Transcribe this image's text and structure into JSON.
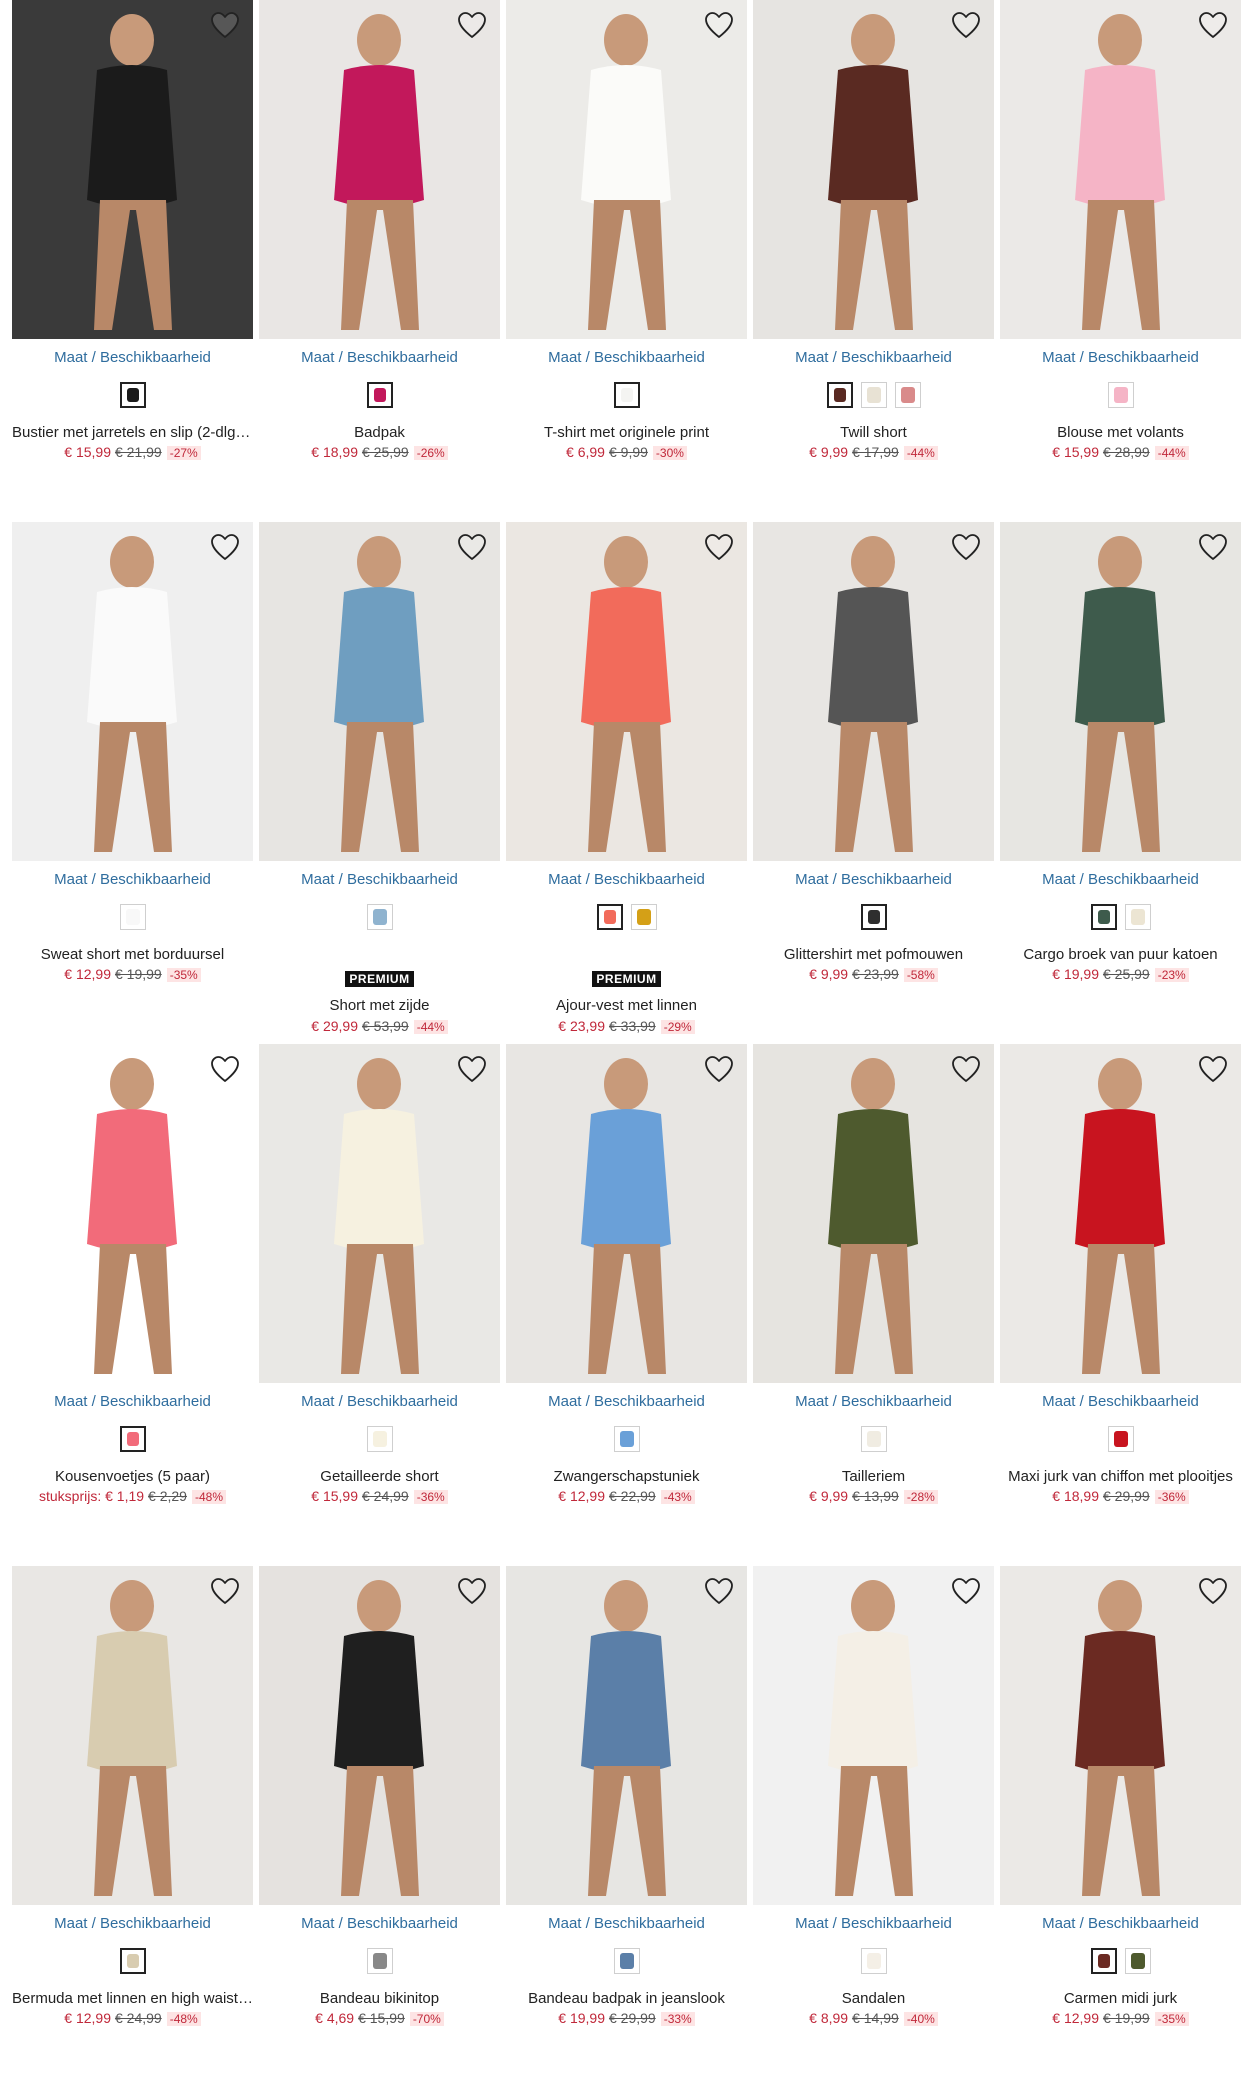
{
  "maat_label": "Maat / Beschikbaarheid",
  "premium_label": "PREMIUM",
  "rows": [
    {
      "products": [
        {
          "name": "Bustier met jarretels en slip (2-dlg. ...",
          "price_prefix": "",
          "price": "€ 15,99",
          "old_price": "€ 21,99",
          "discount": "-27%",
          "premium": false,
          "bg": "#3a3a3a",
          "accent": "#1b1b1b",
          "swatches": [
            {
              "color": "#1a1a1a",
              "selected": true
            }
          ]
        },
        {
          "name": "Badpak",
          "price_prefix": "",
          "price": "€ 18,99",
          "old_price": "€ 25,99",
          "discount": "-26%",
          "premium": false,
          "bg": "#e9e6e4",
          "accent": "#c2185b",
          "swatches": [
            {
              "color": "#c2185b",
              "selected": true
            }
          ]
        },
        {
          "name": "T-shirt met originele print",
          "price_prefix": "",
          "price": "€ 6,99",
          "old_price": "€ 9,99",
          "discount": "-30%",
          "premium": false,
          "bg": "#ecebe8",
          "accent": "#fbfbf9",
          "swatches": [
            {
              "color": "#f4f4f2",
              "selected": true
            }
          ]
        },
        {
          "name": "Twill short",
          "price_prefix": "",
          "price": "€ 9,99",
          "old_price": "€ 17,99",
          "discount": "-44%",
          "premium": false,
          "bg": "#e6e4e1",
          "accent": "#5a2a22",
          "swatches": [
            {
              "color": "#5a2a22",
              "selected": true
            },
            {
              "color": "#e8e2d4",
              "selected": false
            },
            {
              "color": "#d98a8a",
              "selected": false
            }
          ]
        },
        {
          "name": "Blouse met volants",
          "price_prefix": "",
          "price": "€ 15,99",
          "old_price": "€ 28,99",
          "discount": "-44%",
          "premium": false,
          "bg": "#ebe9e7",
          "accent": "#f5b4c6",
          "swatches": [
            {
              "color": "#f5b4c6",
              "selected": false
            }
          ]
        }
      ]
    },
    {
      "products": [
        {
          "name": "Sweat short met borduursel",
          "price_prefix": "",
          "price": "€ 12,99",
          "old_price": "€ 19,99",
          "discount": "-35%",
          "premium": false,
          "bg": "#efefef",
          "accent": "#fafafa",
          "swatches": [
            {
              "color": "#f8f8f8",
              "selected": false
            }
          ]
        },
        {
          "name": "Short met zijde",
          "price_prefix": "",
          "price": "€ 29,99",
          "old_price": "€ 53,99",
          "discount": "-44%",
          "premium": true,
          "bg": "#e7e5e2",
          "accent": "#6f9ec0",
          "swatches": [
            {
              "color": "#8fb3cf",
              "selected": false
            }
          ]
        },
        {
          "name": "Ajour-vest met linnen",
          "price_prefix": "",
          "price": "€ 23,99",
          "old_price": "€ 33,99",
          "discount": "-29%",
          "premium": true,
          "bg": "#ebe7e2",
          "accent": "#f26b5b",
          "swatches": [
            {
              "color": "#f26b5b",
              "selected": true
            },
            {
              "color": "#d4a017",
              "selected": false
            }
          ]
        },
        {
          "name": "Glittershirt met pofmouwen",
          "price_prefix": "",
          "price": "€ 9,99",
          "old_price": "€ 23,99",
          "discount": "-58%",
          "premium": false,
          "bg": "#e8e6e3",
          "accent": "#555555",
          "swatches": [
            {
              "color": "#2e2e2e",
              "selected": true
            }
          ]
        },
        {
          "name": "Cargo broek van puur katoen",
          "price_prefix": "",
          "price": "€ 19,99",
          "old_price": "€ 25,99",
          "discount": "-23%",
          "premium": false,
          "bg": "#e7e6e2",
          "accent": "#3e5b4c",
          "swatches": [
            {
              "color": "#3e5b4c",
              "selected": true
            },
            {
              "color": "#ece5d3",
              "selected": false
            }
          ]
        }
      ]
    },
    {
      "products": [
        {
          "name": "Kousenvoetjes (5 paar)",
          "price_prefix": "stuksprijs:",
          "price": "€ 1,19",
          "old_price": "€ 2,29",
          "discount": "-48%",
          "premium": false,
          "bg": "#ffffff",
          "accent": "#f26b7a",
          "swatches": [
            {
              "color": "#f26b7a",
              "selected": true
            }
          ]
        },
        {
          "name": "Getailleerde short",
          "price_prefix": "",
          "price": "€ 15,99",
          "old_price": "€ 24,99",
          "discount": "-36%",
          "premium": false,
          "bg": "#e9e8e5",
          "accent": "#f6f1e0",
          "swatches": [
            {
              "color": "#f6f1e0",
              "selected": false
            }
          ]
        },
        {
          "name": "Zwangerschapstuniek",
          "price_prefix": "",
          "price": "€ 12,99",
          "old_price": "€ 22,99",
          "discount": "-43%",
          "premium": false,
          "bg": "#e8e6e3",
          "accent": "#6aa0d8",
          "swatches": [
            {
              "color": "#6aa0d8",
              "selected": false
            }
          ]
        },
        {
          "name": "Tailleriem",
          "price_prefix": "",
          "price": "€ 9,99",
          "old_price": "€ 13,99",
          "discount": "-28%",
          "premium": false,
          "bg": "#e6e4e0",
          "accent": "#4e5a2e",
          "swatches": [
            {
              "color": "#f0ece2",
              "selected": false
            }
          ]
        },
        {
          "name": "Maxi jurk van chiffon met plooitjes",
          "price_prefix": "",
          "price": "€ 18,99",
          "old_price": "€ 29,99",
          "discount": "-36%",
          "premium": false,
          "bg": "#ebe9e6",
          "accent": "#c8141f",
          "swatches": [
            {
              "color": "#c8141f",
              "selected": false
            }
          ]
        }
      ]
    },
    {
      "products": [
        {
          "name": "Bermuda met linnen en high waist c...",
          "price_prefix": "",
          "price": "€ 12,99",
          "old_price": "€ 24,99",
          "discount": "-48%",
          "premium": false,
          "bg": "#e9e7e4",
          "accent": "#d8ccb0",
          "swatches": [
            {
              "color": "#d8ccb0",
              "selected": true
            }
          ]
        },
        {
          "name": "Bandeau bikinitop",
          "price_prefix": "",
          "price": "€ 4,69",
          "old_price": "€ 15,99",
          "discount": "-70%",
          "premium": false,
          "bg": "#e5e2df",
          "accent": "#1f1f1f",
          "swatches": [
            {
              "color": "#888888",
              "selected": false
            }
          ]
        },
        {
          "name": "Bandeau badpak in jeanslook",
          "price_prefix": "",
          "price": "€ 19,99",
          "old_price": "€ 29,99",
          "discount": "-33%",
          "premium": false,
          "bg": "#e7e6e3",
          "accent": "#5b7fa8",
          "swatches": [
            {
              "color": "#5b7fa8",
              "selected": false
            }
          ]
        },
        {
          "name": "Sandalen",
          "price_prefix": "",
          "price": "€ 8,99",
          "old_price": "€ 14,99",
          "discount": "-40%",
          "premium": false,
          "bg": "#f1f1f1",
          "accent": "#f4efe6",
          "swatches": [
            {
              "color": "#f4efe6",
              "selected": false
            }
          ]
        },
        {
          "name": "Carmen midi jurk",
          "price_prefix": "",
          "price": "€ 12,99",
          "old_price": "€ 19,99",
          "discount": "-35%",
          "premium": false,
          "bg": "#ebe9e6",
          "accent": "#6b2a22",
          "swatches": [
            {
              "color": "#6b2a22",
              "selected": true
            },
            {
              "color": "#4e5a2e",
              "selected": false
            }
          ]
        }
      ]
    }
  ]
}
